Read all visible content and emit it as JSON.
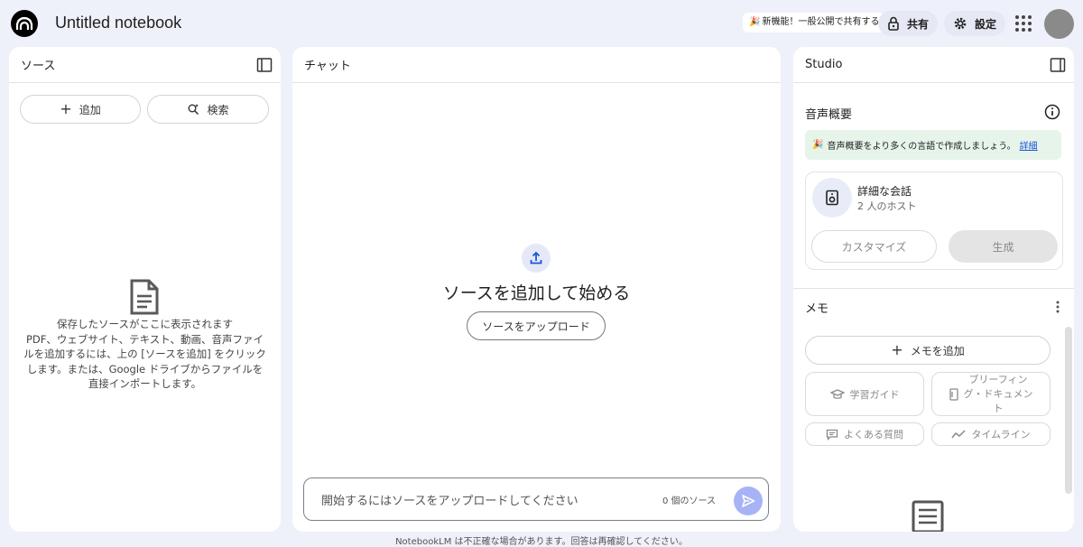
{
  "app": {
    "title": "Untitled notebook",
    "new_feature": "新機能！一般公開で共有する",
    "share_label": "共有",
    "settings_label": "設定"
  },
  "sources": {
    "header": "ソース",
    "add_label": "追加",
    "search_label": "検索",
    "empty_title": "保存したソースがここに表示されます",
    "empty_line1": "PDF、ウェブサイト、テキスト、動画、音声ファイ",
    "empty_line2": "ルを追加するには、上の [ソースを追加] をクリック",
    "empty_line3": "します。または、Google ドライブからファイルを",
    "empty_line4": "直接インポートします。"
  },
  "chat": {
    "header": "チャット",
    "empty_title": "ソースを追加して始める",
    "upload_label": "ソースをアップロード",
    "input_placeholder": "開始するにはソースをアップロードしてください",
    "source_count": "0 個のソース"
  },
  "studio": {
    "header": "Studio",
    "audio_title": "音声概要",
    "banner_text": "音声概要をより多くの言語で作成しましょう。",
    "banner_link": "詳細",
    "card_title": "詳細な会話",
    "card_subtitle": "2 人のホスト",
    "customize_label": "カスタマイズ",
    "generate_label": "生成",
    "memo_title": "メモ",
    "add_memo_label": "メモを追加",
    "study_guide_label": "学習ガイド",
    "briefing_line1": "ブリーフィン",
    "briefing_line2": "グ・ドキュメン",
    "briefing_line3": "ト",
    "faq_label": "よくある質問",
    "timeline_label": "タイムライン"
  },
  "footer": {
    "note": "NotebookLM は不正確な場合があります。回答は再確認してください。"
  },
  "colors": {
    "background": "#eef0fa",
    "send_button": "#a7b3f7",
    "banner_bg": "#e6f4ea",
    "link": "#1a56d6"
  },
  "icons": [
    "notebooklm-logo-icon",
    "lock-icon",
    "gear-icon",
    "apps-grid-icon",
    "panel-collapse-icon",
    "plus-icon",
    "sparkle-search-icon",
    "document-icon",
    "upload-icon",
    "send-icon",
    "info-icon",
    "party-icon",
    "speaker-icon",
    "more-vert-icon",
    "graduation-cap-icon",
    "briefing-doc-icon",
    "faq-icon",
    "timeline-icon",
    "note-icon"
  ]
}
